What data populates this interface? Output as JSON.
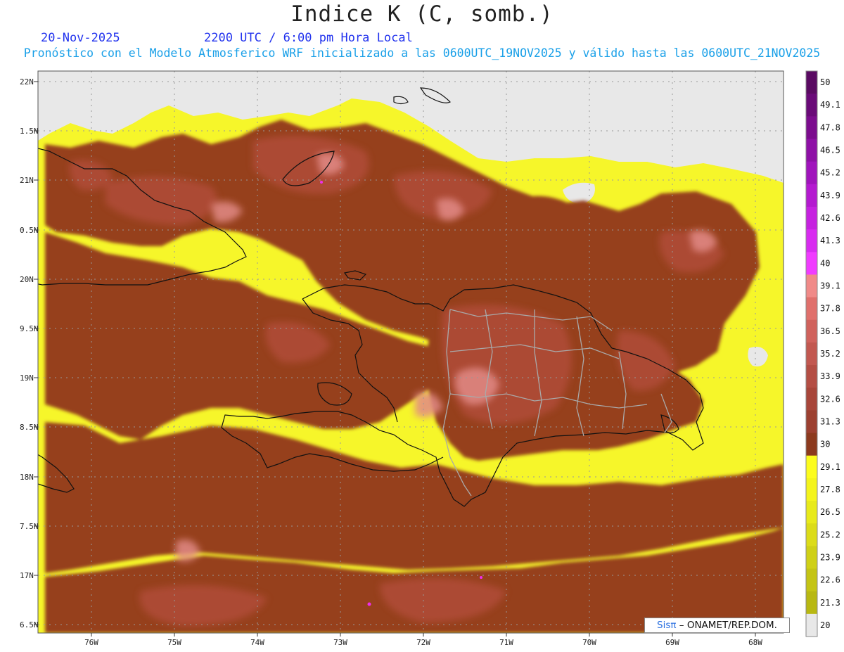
{
  "header": {
    "title": "Indice K (C, somb.)",
    "date": "20-Nov-2025",
    "time": "2200 UTC / 6:00 pm Hora Local",
    "forecast": "Pronóstico con el Modelo Atmosferico WRF inicializado a las 0600UTC_19NOV2025 y válido hasta las  0600UTC_21NOV2025"
  },
  "map": {
    "lat_labels": [
      "22N",
      "1.5N",
      "21N",
      "0.5N",
      "20N",
      "9.5N",
      "19N",
      "8.5N",
      "18N",
      "7.5N",
      "17N",
      "6.5N"
    ],
    "lon_labels": [
      "76W",
      "75W",
      "74W",
      "73W",
      "72W",
      "71W",
      "70W",
      "69W",
      "68W"
    ],
    "colors": {
      "no_data": "#e8e8e8",
      "yellow": "#f6f62a",
      "dark_brown": "#96401f",
      "mid_brown": "#b24e3a",
      "light_brown": "#c8645a",
      "pink": "#e28a86",
      "coast": "#111111",
      "province": "#a9a9a9"
    }
  },
  "colorbar": {
    "labels": [
      "50",
      "49.1",
      "47.8",
      "46.5",
      "45.2",
      "43.9",
      "42.6",
      "41.3",
      "40",
      "39.1",
      "37.8",
      "36.5",
      "35.2",
      "33.9",
      "32.6",
      "31.3",
      "30",
      "29.1",
      "27.8",
      "26.5",
      "25.2",
      "23.9",
      "22.6",
      "21.3",
      "20"
    ],
    "colors": [
      "#5a0a62",
      "#6a0a78",
      "#7c0c8e",
      "#8e10a6",
      "#a014bc",
      "#b41ad0",
      "#c622e0",
      "#d82cf0",
      "#f03cff",
      "#f08a88",
      "#e0706c",
      "#d0625c",
      "#c25850",
      "#b44e44",
      "#a8463a",
      "#9c4030",
      "#8c3a1e",
      "#fcfc1e",
      "#f4f41c",
      "#e8ea1a",
      "#dcdc18",
      "#cfd016",
      "#c4c414",
      "#b8b812",
      "#e8e8e8"
    ]
  },
  "credit": {
    "brand": "Sisπ",
    "text": " – ONAMET/REP.DOM."
  }
}
